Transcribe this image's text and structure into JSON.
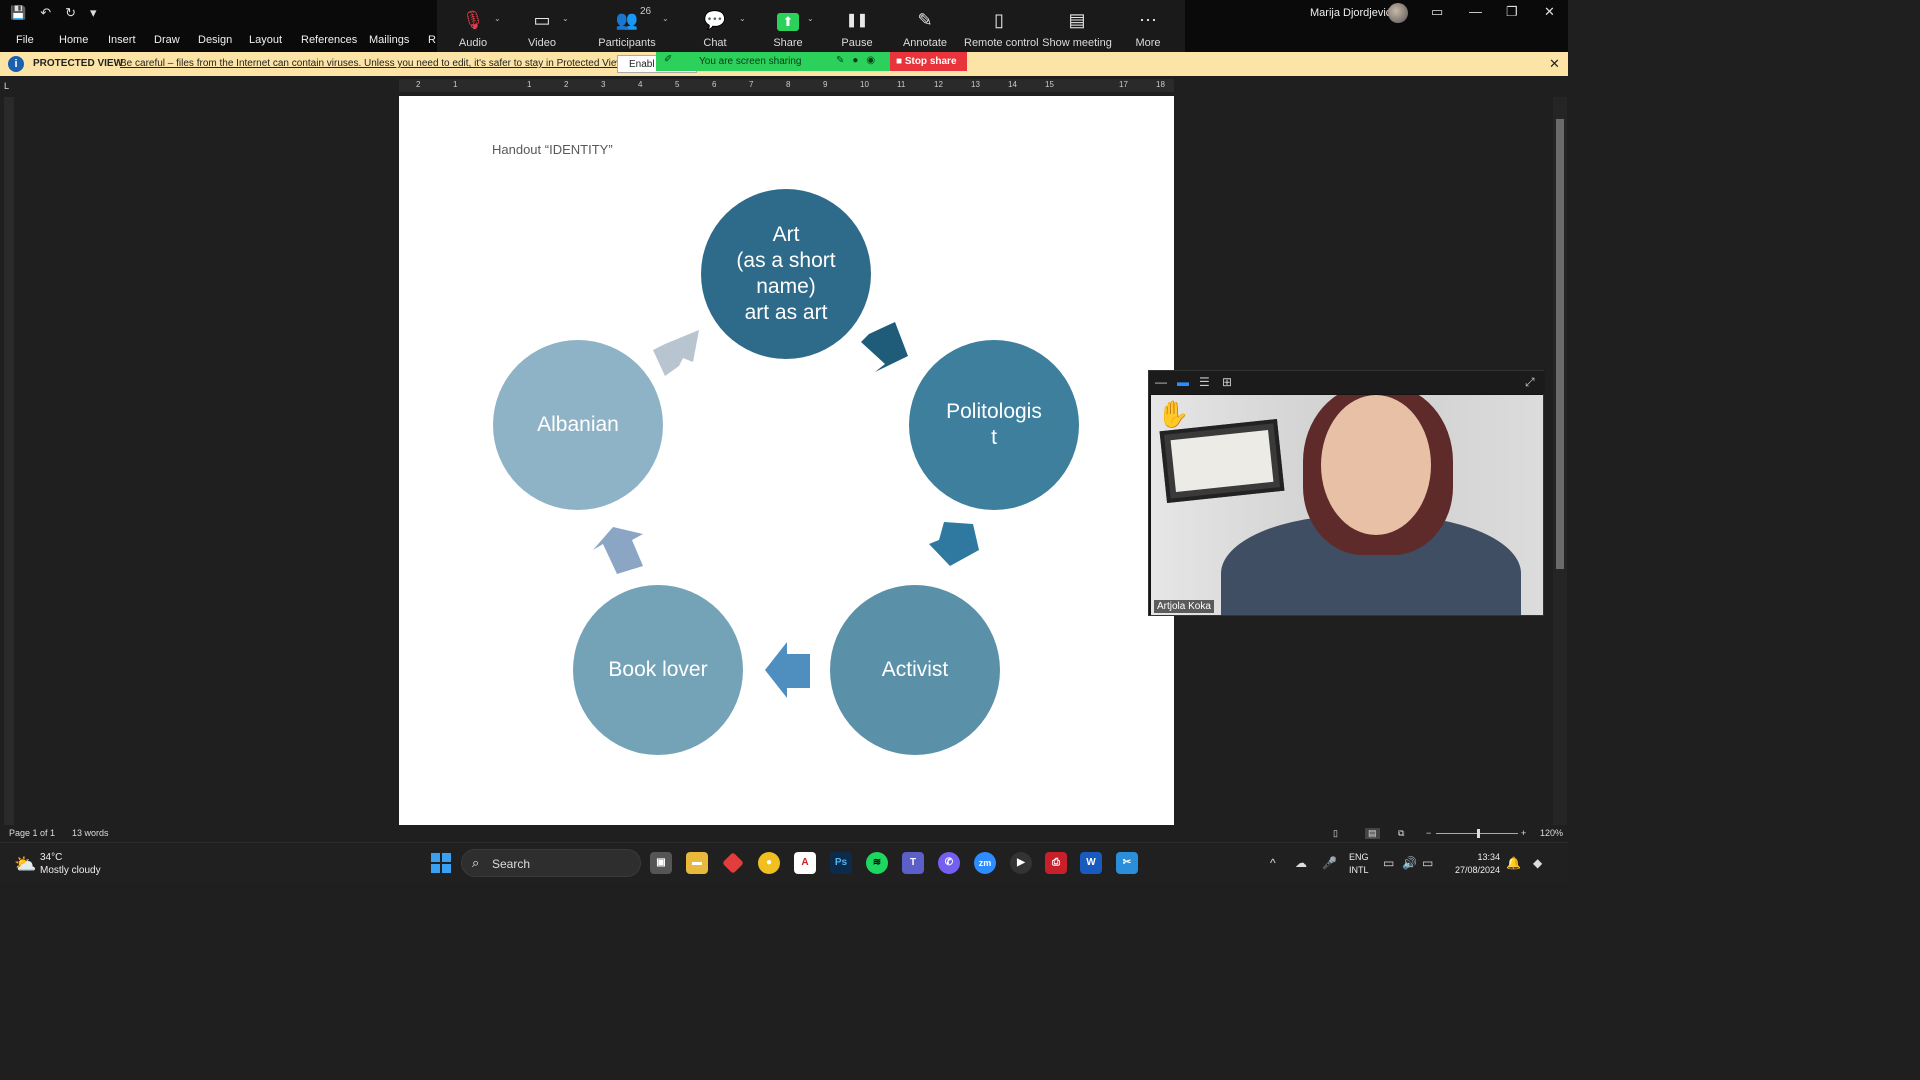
{
  "window": {
    "user_name": "Marija Djordjević",
    "controls": [
      "—",
      "❐",
      "✕"
    ]
  },
  "ribbon": {
    "tabs": [
      "File",
      "Home",
      "Insert",
      "Draw",
      "Design",
      "Layout",
      "References",
      "Mailings",
      "R"
    ]
  },
  "zoom_toolbar": {
    "participants_count": "26",
    "buttons": [
      {
        "label": "Audio",
        "icon": "mic-muted-icon",
        "glyph": "🎙"
      },
      {
        "label": "Video",
        "icon": "video-camera-icon",
        "glyph": "▭"
      },
      {
        "label": "Participants",
        "icon": "participants-icon",
        "glyph": "👥"
      },
      {
        "label": "Chat",
        "icon": "chat-icon",
        "glyph": "💬"
      },
      {
        "label": "Share",
        "icon": "share-screen-icon",
        "glyph": "⬆"
      },
      {
        "label": "Pause",
        "icon": "pause-icon",
        "glyph": "❚❚"
      },
      {
        "label": "Annotate",
        "icon": "pencil-icon",
        "glyph": "✎"
      },
      {
        "label": "Remote control",
        "icon": "mouse-icon",
        "glyph": "▯"
      },
      {
        "label": "Show meeting",
        "icon": "window-icon",
        "glyph": "▤"
      },
      {
        "label": "More",
        "icon": "more-icon",
        "glyph": "⋯"
      }
    ]
  },
  "protected_view": {
    "title": "PROTECTED VIEW",
    "message": "Be careful – files from the Internet can contain viruses. Unless you need to edit, it's safer to stay in Protected View.",
    "enable_button": "Enabl"
  },
  "sharing_banner": {
    "text": "You are screen sharing",
    "stop_label": "Stop share"
  },
  "ruler": {
    "numbers": [
      "2",
      "1",
      "",
      "1",
      "2",
      "3",
      "4",
      "5",
      "6",
      "7",
      "8",
      "9",
      "10",
      "11",
      "12",
      "13",
      "14",
      "15",
      "",
      "17",
      "18"
    ]
  },
  "document": {
    "heading": "Handout “IDENTITY”",
    "cycle": [
      {
        "label": "Art\n(as a short\nname)\nart as art",
        "color": "#2e6b8a"
      },
      {
        "label": "Politologis\nt",
        "color": "#3d7f9c"
      },
      {
        "label": "Activist",
        "color": "#5a90a8"
      },
      {
        "label": "Book lover",
        "color": "#74a3b8"
      },
      {
        "label": "Albanian",
        "color": "#8fb3c6"
      }
    ],
    "arrow_colors": [
      "#1e5c7a",
      "#2f78a0",
      "#4f8fbf",
      "#8aa6c4",
      "#b8c4cf"
    ]
  },
  "video_panel": {
    "participant_name": "Artjola Koka",
    "reaction": "✋"
  },
  "status_bar": {
    "page": "Page 1 of 1",
    "words": "13 words",
    "zoom": "120%"
  },
  "taskbar": {
    "weather_temp": "34°C",
    "weather_desc": "Mostly cloudy",
    "search_placeholder": "Search",
    "lang_top": "ENG",
    "lang_bottom": "INTL",
    "time": "13:34",
    "date": "27/08/2024"
  }
}
